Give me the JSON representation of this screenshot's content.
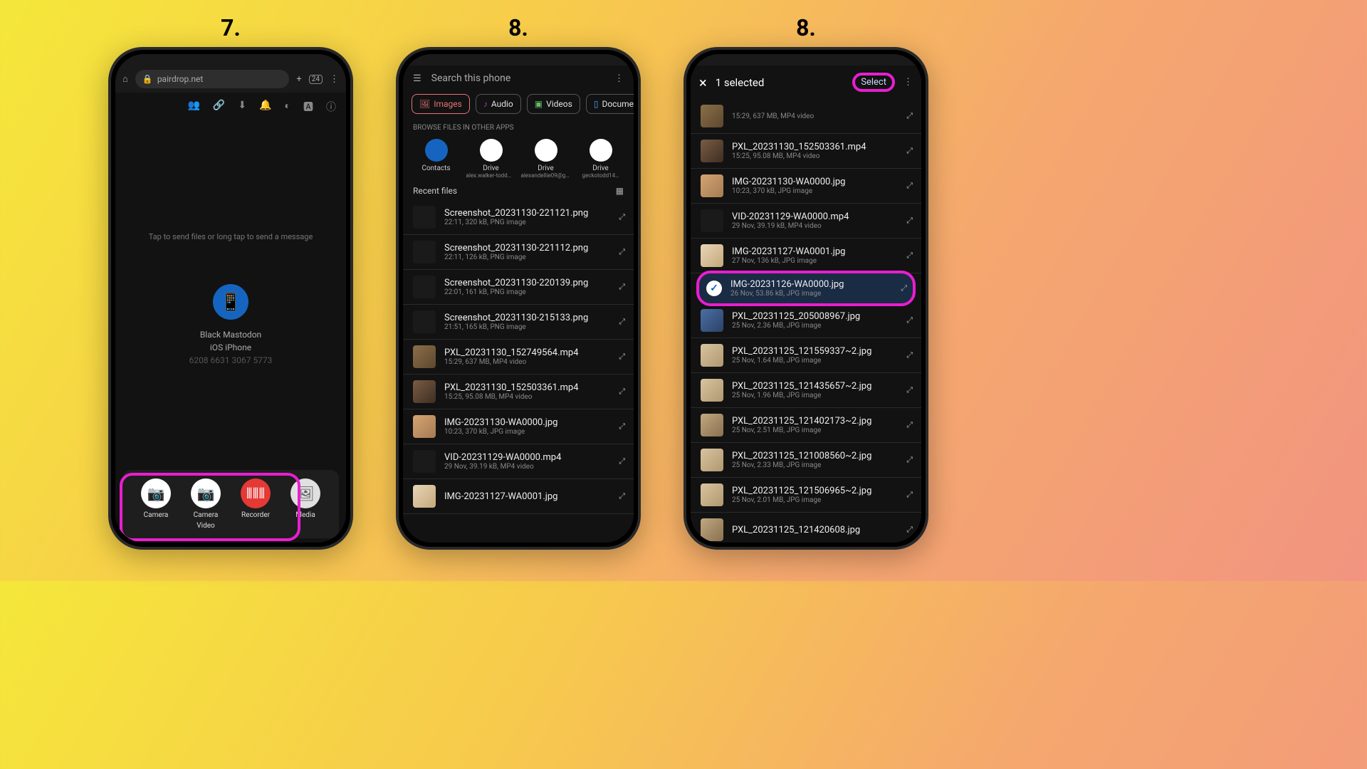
{
  "steps": [
    "7.",
    "8.",
    "8."
  ],
  "phone7": {
    "url": "pairdrop.net",
    "tab_count": "24",
    "hint": "Tap to send files or long tap to send a message",
    "device_name": "Black Mastodon",
    "device_os": "iOS iPhone",
    "device_code": "6208 6631 3067 5773",
    "actions": [
      {
        "label": "Camera",
        "sub": ""
      },
      {
        "label": "Camera",
        "sub": "Video"
      },
      {
        "label": "Recorder",
        "sub": ""
      },
      {
        "label": "Media",
        "sub": ""
      }
    ]
  },
  "phone8a": {
    "search_placeholder": "Search this phone",
    "filters": [
      "Images",
      "Audio",
      "Videos",
      "Documents"
    ],
    "browse_label": "BROWSE FILES IN OTHER APPS",
    "apps": [
      {
        "name": "Contacts",
        "sub": ""
      },
      {
        "name": "Drive",
        "sub": "alex.walker-todd@f…"
      },
      {
        "name": "Drive",
        "sub": "alexandellie09@gm…"
      },
      {
        "name": "Drive",
        "sub": "geckotodd14…"
      }
    ],
    "recent_label": "Recent files",
    "files": [
      {
        "name": "Screenshot_20231130-221121.png",
        "meta": "22:11, 320 kB, PNG image",
        "cls": "dk"
      },
      {
        "name": "Screenshot_20231130-221112.png",
        "meta": "22:11, 126 kB, PNG image",
        "cls": "dk"
      },
      {
        "name": "Screenshot_20231130-220139.png",
        "meta": "22:01, 161 kB, PNG image",
        "cls": "dk"
      },
      {
        "name": "Screenshot_20231130-215133.png",
        "meta": "21:51, 165 kB, PNG image",
        "cls": "dk"
      },
      {
        "name": "PXL_20231130_152749564.mp4",
        "meta": "15:29, 637 MB, MP4 video",
        "cls": "t1"
      },
      {
        "name": "PXL_20231130_152503361.mp4",
        "meta": "15:25, 95.08 MB, MP4 video",
        "cls": "t2"
      },
      {
        "name": "IMG-20231130-WA0000.jpg",
        "meta": "10:23, 370 kB, JPG image",
        "cls": "t3"
      },
      {
        "name": "VID-20231129-WA0000.mp4",
        "meta": "29 Nov, 39.19 kB, MP4 video",
        "cls": "dk"
      },
      {
        "name": "IMG-20231127-WA0001.jpg",
        "meta": "",
        "cls": "t4"
      }
    ]
  },
  "phone8b": {
    "close": "×",
    "title": "1 selected",
    "select_label": "Select",
    "files": [
      {
        "name": "",
        "meta": "15:29, 637 MB, MP4 video",
        "cls": "t1",
        "selected": false
      },
      {
        "name": "PXL_20231130_152503361.mp4",
        "meta": "15:25, 95.08 MB, MP4 video",
        "cls": "t2",
        "selected": false
      },
      {
        "name": "IMG-20231130-WA0000.jpg",
        "meta": "10:23, 370 kB, JPG image",
        "cls": "t3",
        "selected": false
      },
      {
        "name": "VID-20231129-WA0000.mp4",
        "meta": "29 Nov, 39.19 kB, MP4 video",
        "cls": "dk",
        "selected": false
      },
      {
        "name": "IMG-20231127-WA0001.jpg",
        "meta": "27 Nov, 136 kB, JPG image",
        "cls": "t4",
        "selected": false
      },
      {
        "name": "IMG-20231126-WA0000.jpg",
        "meta": "26 Nov, 53.86 kB, JPG image",
        "cls": "",
        "selected": true
      },
      {
        "name": "PXL_20231125_205008967.jpg",
        "meta": "25 Nov, 2.36 MB, JPG image",
        "cls": "t5",
        "selected": false
      },
      {
        "name": "PXL_20231125_121559337~2.jpg",
        "meta": "25 Nov, 1.64 MB, JPG image",
        "cls": "t6",
        "selected": false
      },
      {
        "name": "PXL_20231125_121435657~2.jpg",
        "meta": "25 Nov, 1.96 MB, JPG image",
        "cls": "t6",
        "selected": false
      },
      {
        "name": "PXL_20231125_121402173~2.jpg",
        "meta": "25 Nov, 2.51 MB, JPG image",
        "cls": "t7",
        "selected": false
      },
      {
        "name": "PXL_20231125_121008560~2.jpg",
        "meta": "25 Nov, 2.33 MB, JPG image",
        "cls": "t6",
        "selected": false
      },
      {
        "name": "PXL_20231125_121506965~2.jpg",
        "meta": "25 Nov, 2.01 MB, JPG image",
        "cls": "t6",
        "selected": false
      },
      {
        "name": "PXL_20231125_121420608.jpg",
        "meta": "",
        "cls": "t7",
        "selected": false
      }
    ]
  }
}
